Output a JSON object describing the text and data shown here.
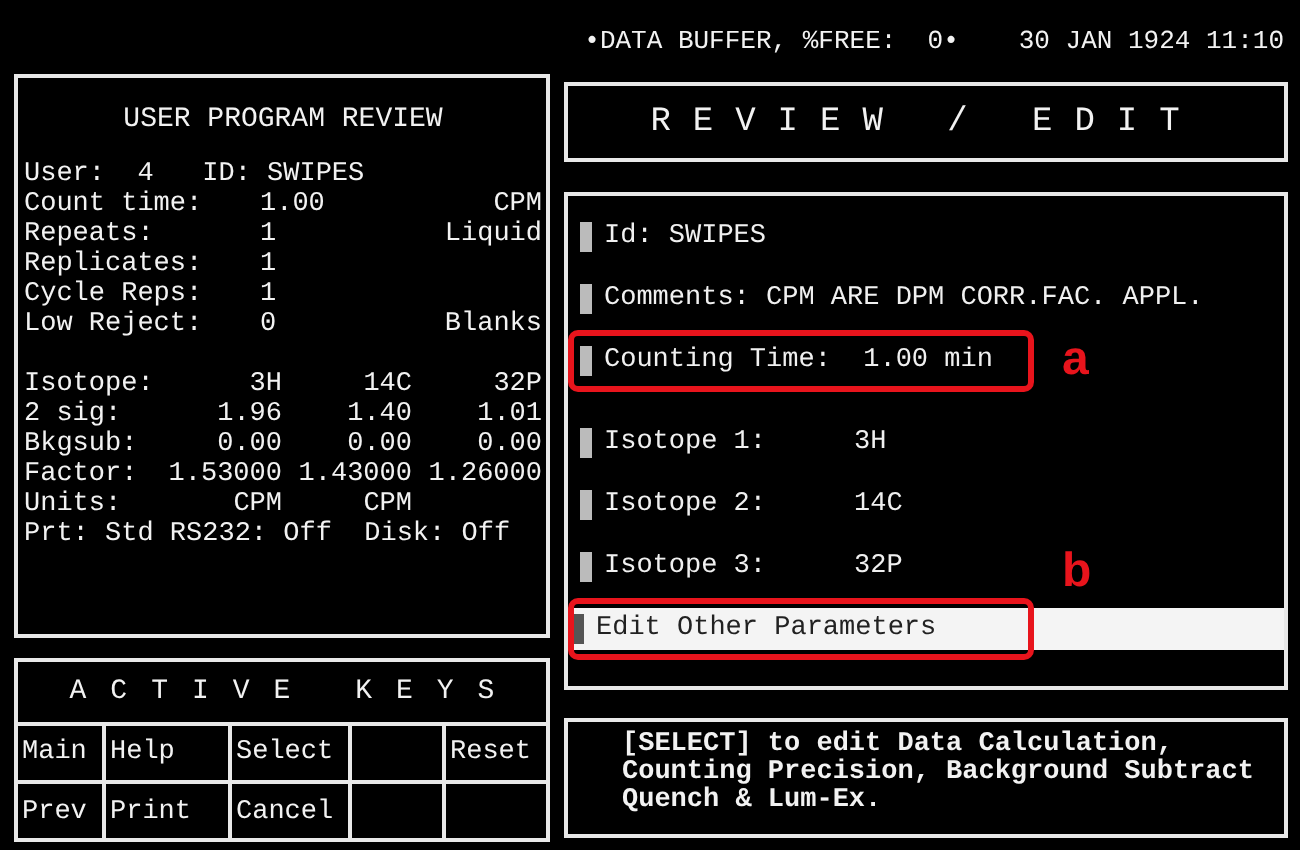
{
  "status_bar": {
    "buffer": "•DATA BUFFER, %FREE:  0•",
    "datetime": "30 JAN 1924 11:10"
  },
  "program_review": {
    "title": "USER PROGRAM REVIEW",
    "header": "User:  4   ID: SWIPES",
    "rows": [
      {
        "label": "Count time:",
        "value": "1.00",
        "note": "CPM"
      },
      {
        "label": "Repeats:",
        "value": "1",
        "note": "Liquid"
      },
      {
        "label": "Replicates:",
        "value": "1"
      },
      {
        "label": "Cycle Reps:",
        "value": "1"
      },
      {
        "label": "Low Reject:",
        "value": "0",
        "note": "Blanks"
      }
    ],
    "isotope_rows": [
      {
        "label": "Isotope:",
        "values": [
          "3H",
          "14C",
          "32P"
        ]
      },
      {
        "label": "2 sig:",
        "values": [
          "1.96",
          "1.40",
          "1.01"
        ]
      },
      {
        "label": "Bkgsub:",
        "values": [
          "0.00",
          "0.00",
          "0.00"
        ]
      },
      {
        "label": "Factor:",
        "values": [
          "1.53000",
          "1.43000",
          "1.26000"
        ]
      },
      {
        "label": "Units:",
        "values": [
          "CPM",
          "CPM"
        ]
      }
    ],
    "footer": "Prt: Std RS232: Off  Disk: Off"
  },
  "active_keys": {
    "title": "ACTIVE KEYS",
    "rows": [
      [
        "Main",
        "Help",
        "Select",
        null,
        "Reset"
      ],
      [
        "Prev",
        "Print",
        "Cancel",
        null,
        null
      ]
    ]
  },
  "review_edit": {
    "title": "REVIEW / EDIT",
    "groups": [
      [
        {
          "label": "Id: SWIPES",
          "selected": false
        },
        {
          "label": "Comments: CPM ARE DPM CORR.FAC. APPL.",
          "selected": false
        },
        {
          "label": "Counting Time:  1.00 min",
          "selected": false,
          "callout": "a"
        }
      ],
      [
        {
          "label": "Isotope 1:",
          "value": "3H",
          "selected": false
        },
        {
          "label": "Isotope 2:",
          "value": "14C",
          "selected": false
        },
        {
          "label": "Isotope 3:",
          "value": "32P",
          "selected": false
        },
        {
          "label": "Edit Other Parameters",
          "selected": true,
          "callout": "b"
        }
      ]
    ]
  },
  "hint": "[SELECT] to edit Data Calculation,\nCounting Precision, Background Subtract\nQuench & Lum-Ex."
}
